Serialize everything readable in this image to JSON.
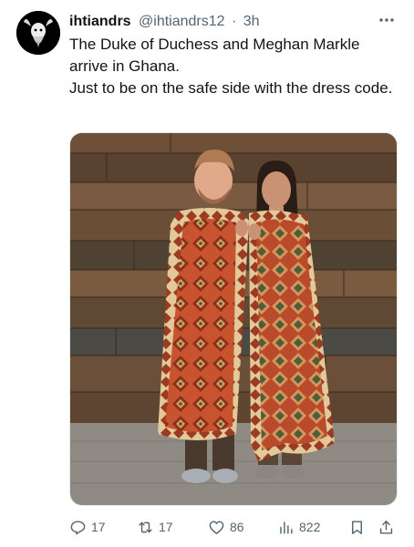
{
  "post": {
    "author": {
      "display_name": "ihtiandrs",
      "handle": "@ihtiandrs12",
      "separator": "·",
      "time": "3h",
      "avatar_icon": "goat-avatar-icon"
    },
    "text_lines": [
      "The Duke of Duchess and Meghan Markle arrive in Ghana.",
      "Just to be on the safe side with the dress code."
    ]
  },
  "actions": {
    "replies": "17",
    "reposts": "17",
    "likes": "86",
    "views": "822"
  },
  "icons": {
    "more": "more-dots-icon",
    "reply": "reply-icon",
    "repost": "repost-icon",
    "like": "heart-icon",
    "views": "views-icon",
    "bookmark": "bookmark-icon",
    "share": "share-icon"
  },
  "colors": {
    "text": "#0f1419",
    "secondary": "#536471",
    "background": "#ffffff"
  }
}
